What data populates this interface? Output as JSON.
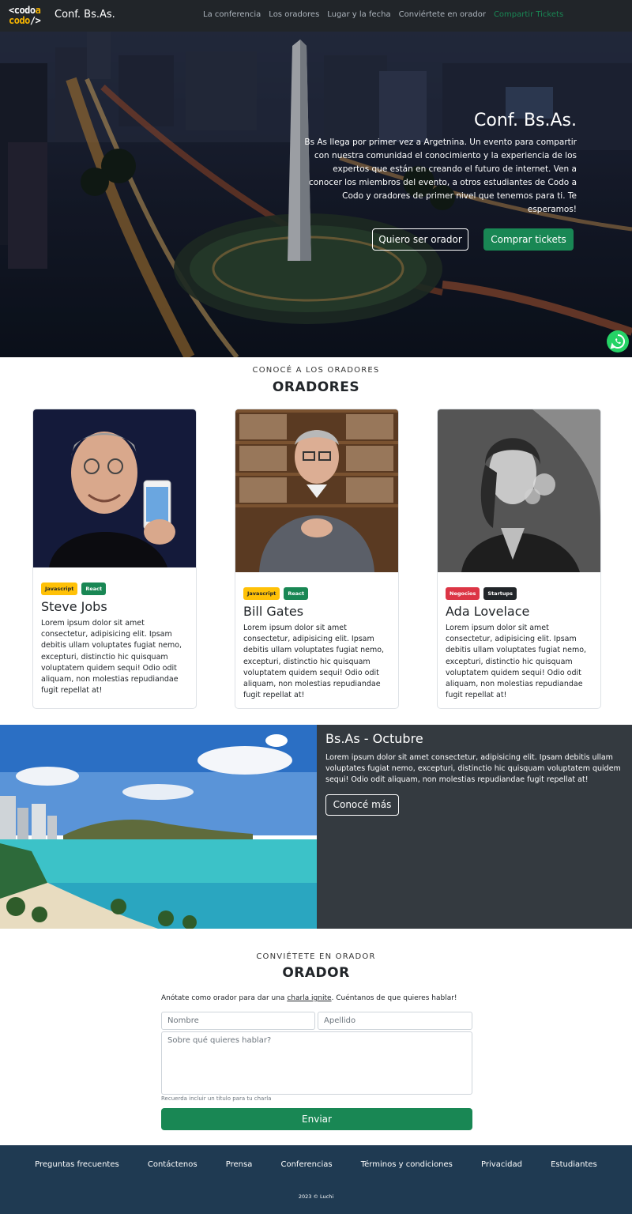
{
  "navbar": {
    "logo": {
      "line1a": "<codo",
      "line1b": "a",
      "line2a": "codo",
      "line2b": "/>"
    },
    "brand": "Conf. Bs.As.",
    "links": [
      "La conferencia",
      "Los oradores",
      "Lugar y la fecha",
      "Conviértete en orador",
      "Compartir Tickets"
    ]
  },
  "hero": {
    "title": "Conf. Bs.As.",
    "text": "Bs As llega por primer vez a Argetnina. Un evento para compartir con nuestra comunidad el conocimiento y la experiencia de los expertos que están en creando el futuro de internet. Ven a conocer los miembros del evento, a otros estudiantes de Codo a Codo y oradores de primer nivel que tenemos para ti. Te esperamos!",
    "btn_speaker": "Quiero ser orador",
    "btn_tickets": "Comprar tickets"
  },
  "speakers_section": {
    "subtitle": "CONOCÉ A LOS ORADORES",
    "title": "ORADORES",
    "cards": [
      {
        "name": "Steve Jobs",
        "badges": [
          "Javascript",
          "React"
        ],
        "text": "Lorem ipsum dolor sit amet consectetur, adipisicing elit. Ipsam debitis ullam voluptates fugiat nemo, excepturi, distinctio hic quisquam voluptatem quidem sequi! Odio odit aliquam, non molestias repudiandae fugit repellat at!"
      },
      {
        "name": "Bill Gates",
        "badges": [
          "Javascript",
          "React"
        ],
        "text": "Lorem ipsum dolor sit amet consectetur, adipisicing elit. Ipsam debitis ullam voluptates fugiat nemo, excepturi, distinctio hic quisquam voluptatem quidem sequi! Odio odit aliquam, non molestias repudiandae fugit repellat at!"
      },
      {
        "name": "Ada Lovelace",
        "badges": [
          "Negocios",
          "Startups"
        ],
        "text": "Lorem ipsum dolor sit amet consectetur, adipisicing elit. Ipsam debitis ullam voluptates fugiat nemo, excepturi, distinctio hic quisquam voluptatem quidem sequi! Odio odit aliquam, non molestias repudiandae fugit repellat at!"
      }
    ]
  },
  "location": {
    "title": "Bs.As - Octubre",
    "text": "Lorem ipsum dolor sit amet consectetur, adipisicing elit. Ipsam debitis ullam voluptates fugiat nemo, excepturi, distinctio hic quisquam voluptatem quidem sequi! Odio odit aliquam, non molestias repudiandae fugit repellat at!",
    "button": "Conocé más"
  },
  "form_section": {
    "subtitle": "CONVIÉTETE EN ORADOR",
    "title": "ORADOR",
    "intro_before": "Anótate como orador para dar una ",
    "intro_link": "charla ignite",
    "intro_after": ". Cuéntanos de que quieres hablar!",
    "first_name_placeholder": "Nombre",
    "last_name_placeholder": "Apellido",
    "topic_placeholder": "Sobre qué quieres hablar?",
    "hint": "Recuerda incluir un título para tu charla",
    "submit": "Enviar"
  },
  "footer": {
    "links": [
      "Preguntas frecuentes",
      "Contáctenos",
      "Prensa",
      "Conferencias",
      "Términos y condiciones",
      "Privacidad",
      "Estudiantes"
    ],
    "copyright": "2023 © Luchi"
  },
  "colors": {
    "accent_green": "#198754",
    "navbar": "#212529",
    "footer": "#1f3a52",
    "dark_panel": "#343a40"
  }
}
